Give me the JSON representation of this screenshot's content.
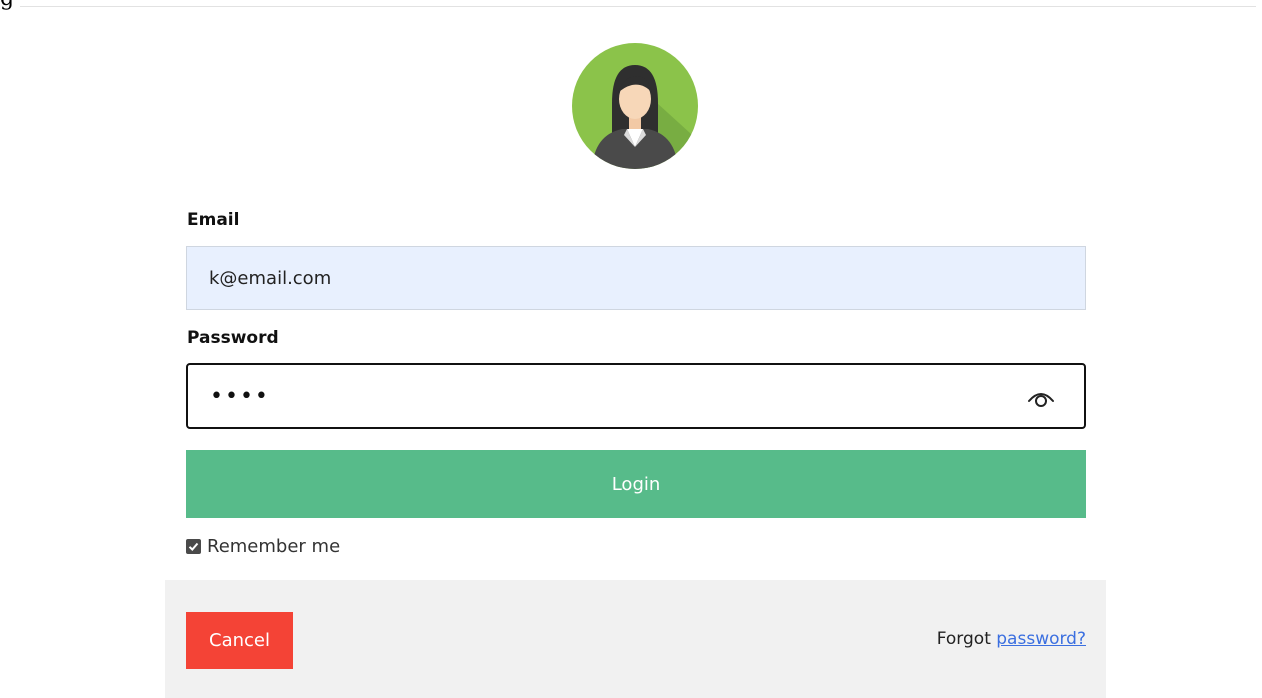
{
  "page": {
    "title_fragment": "g"
  },
  "avatar": {
    "icon": "user-avatar-icon",
    "bg_color": "#8bc34a"
  },
  "form": {
    "email_label": "Email",
    "email_value": "k@email.com",
    "password_label": "Password",
    "password_value": "••••",
    "show_password_icon": "eye-icon",
    "login_label": "Login",
    "login_color": "#57bb8a",
    "remember_label": "Remember me",
    "remember_checked": true
  },
  "footer": {
    "cancel_label": "Cancel",
    "cancel_color": "#f44336",
    "forgot_text": "Forgot",
    "forgot_link": "password?"
  }
}
